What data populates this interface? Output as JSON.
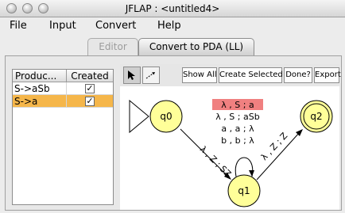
{
  "window": {
    "title": "JFLAP : <untitled4>"
  },
  "menu": [
    "File",
    "Input",
    "Convert",
    "Help"
  ],
  "tabs": [
    {
      "label": "Editor",
      "active": false
    },
    {
      "label": "Convert to PDA (LL)",
      "active": true
    }
  ],
  "table": {
    "headers": [
      "Produc...",
      "Created"
    ],
    "rows": [
      {
        "production": "S->aSb",
        "created": true,
        "selected": false
      },
      {
        "production": "S->a",
        "created": true,
        "selected": true
      }
    ]
  },
  "toolbar": {
    "tools": [
      {
        "icon": "arrow-pointer-icon",
        "pressed": true
      },
      {
        "icon": "transition-arrow-icon",
        "pressed": false
      }
    ],
    "buttons": [
      "Show All",
      "Create Selected",
      "Done?",
      "Export"
    ]
  },
  "automaton": {
    "states": [
      {
        "name": "q0",
        "initial": true,
        "final": false
      },
      {
        "name": "q1",
        "initial": false,
        "final": false
      },
      {
        "name": "q2",
        "initial": false,
        "final": true
      }
    ],
    "transitions": [
      {
        "from": "q0",
        "to": "q1",
        "label": "λ , Z ; SZ"
      },
      {
        "from": "q1",
        "to": "q2",
        "label": "λ , Z ; Z"
      },
      {
        "from": "q1",
        "to": "q1",
        "labels": [
          {
            "text": "λ , S ; a",
            "highlight": true
          },
          {
            "text": "λ , S ; aSb",
            "highlight": false
          },
          {
            "text": "a , a ; λ",
            "highlight": false
          },
          {
            "text": "b , b ; λ",
            "highlight": false
          }
        ]
      }
    ]
  },
  "colors": {
    "state_fill": "#ffff99",
    "selected_row": "#f5b64a",
    "highlight_transition": "#f08080"
  }
}
